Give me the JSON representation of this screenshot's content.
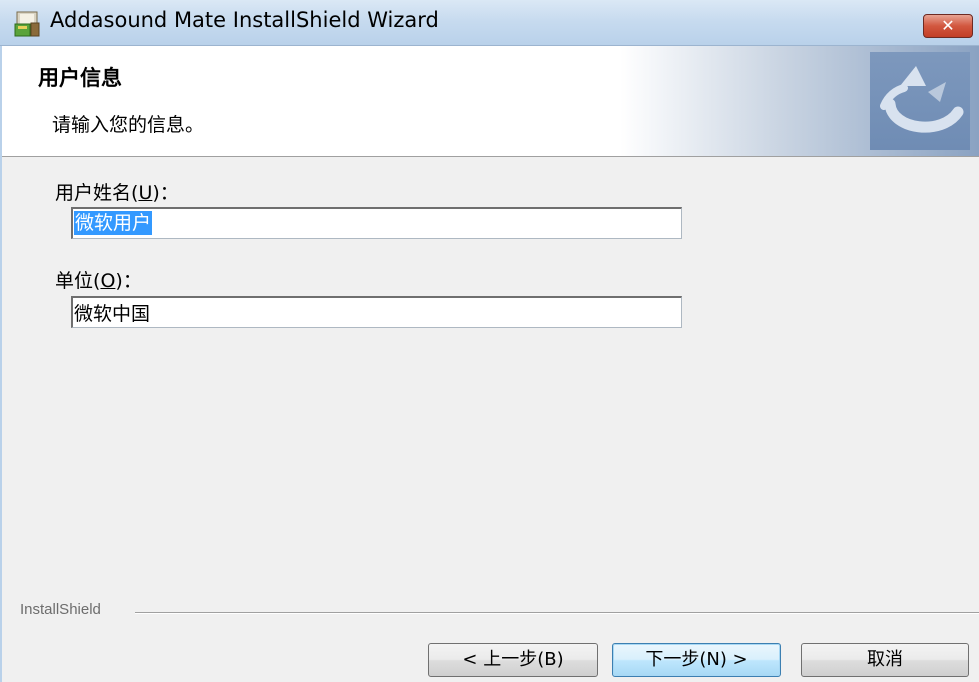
{
  "window": {
    "title": "Addasound Mate InstallShield Wizard",
    "close_label": "✕"
  },
  "header": {
    "title": "用户信息",
    "subtitle": "请输入您的信息。"
  },
  "form": {
    "username": {
      "label": "用户姓名",
      "hotkey": "U",
      "value": "微软用户"
    },
    "organization": {
      "label": "单位",
      "hotkey": "O",
      "value": "微软中国"
    }
  },
  "footer": {
    "brand": "InstallShield",
    "back_label": "< 上一步(B)",
    "next_label": "下一步(N) >",
    "cancel_label": "取消"
  },
  "colors": {
    "selection": "#3399ff",
    "default_button_border": "#3c7fb1",
    "logo": "#6f8cb4"
  },
  "icons": {
    "app_icon": "installer-icon",
    "close_icon": "close-icon",
    "header_logo": "installshield-logo"
  }
}
